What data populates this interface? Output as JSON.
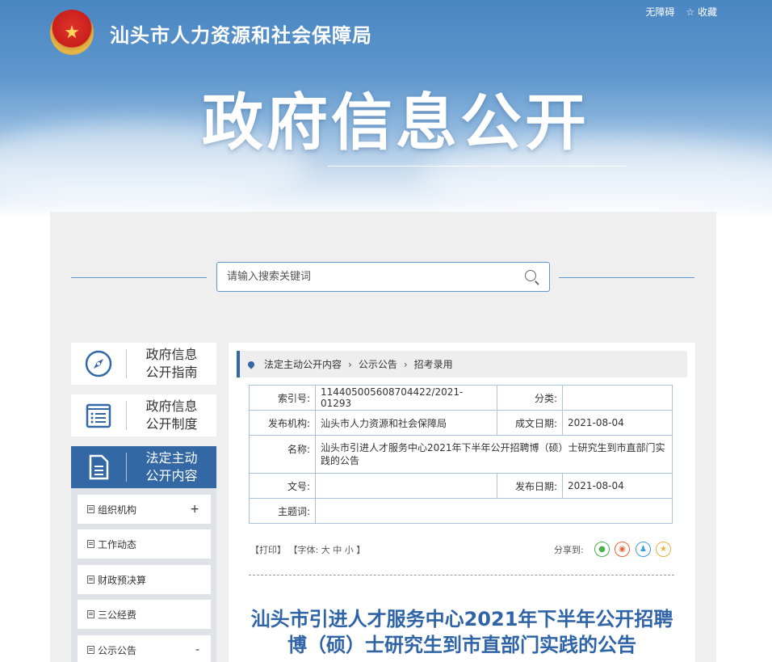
{
  "header": {
    "site_title": "汕头市人力资源和社会保障局",
    "top_links": [
      "无障碍",
      "收藏"
    ],
    "banner_title": "政府信息公开"
  },
  "search": {
    "placeholder": "请输入搜索关键词",
    "value": ""
  },
  "sidebar": {
    "nav": [
      {
        "label_line1": "政府信息",
        "label_line2": "公开指南",
        "icon": "compass-icon",
        "active": false
      },
      {
        "label_line1": "政府信息",
        "label_line2": "公开制度",
        "icon": "list-document-icon",
        "active": false
      },
      {
        "label_line1": "法定主动",
        "label_line2": "公开内容",
        "icon": "document-icon",
        "active": true
      }
    ],
    "sub_items": [
      {
        "label": "组织机构",
        "toggle": "+"
      },
      {
        "label": "工作动态",
        "toggle": ""
      },
      {
        "label": "财政预决算",
        "toggle": ""
      },
      {
        "label": "三公经费",
        "toggle": ""
      },
      {
        "label": "公示公告",
        "toggle": "-"
      }
    ]
  },
  "breadcrumb": [
    "法定主动公开内容",
    "公示公告",
    "招考录用"
  ],
  "meta": {
    "index_label": "索引号:",
    "index_value": "114405005608704422/2021-01293",
    "category_label": "分类:",
    "category_value": "",
    "publisher_label": "发布机构:",
    "publisher_value": "汕头市人力资源和社会保障局",
    "created_label": "成文日期:",
    "created_value": "2021-08-04",
    "name_label": "名称:",
    "name_value": "汕头市引进人才服务中心2021年下半年公开招聘博（硕）士研究生到市直部门实践的公告",
    "docno_label": "文号:",
    "docno_value": "",
    "published_label": "发布日期:",
    "published_value": "2021-08-04",
    "keywords_label": "主题词:",
    "keywords_value": ""
  },
  "toolbar": {
    "print": "【打印】",
    "font_label": "【字体:",
    "font_large": "大",
    "font_medium": "中",
    "font_small": "小",
    "font_end": "】",
    "share_label": "分享到:"
  },
  "article": {
    "title_line1": "汕头市引进人才服务中心2021年下半年公开招聘",
    "title_line2": "博（硕）士研究生到市直部门实践的公告"
  }
}
